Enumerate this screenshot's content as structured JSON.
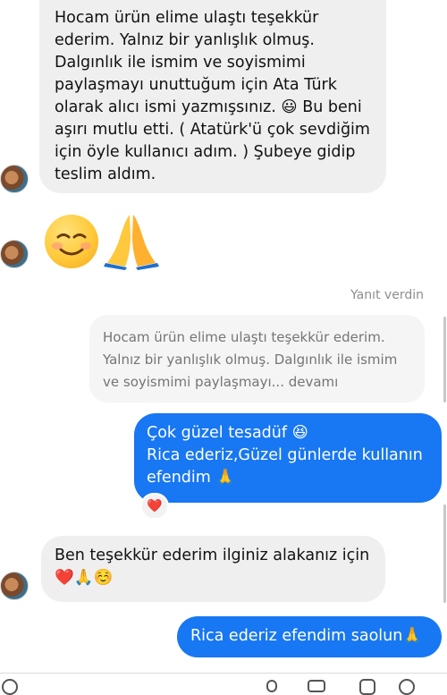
{
  "messages": {
    "m1": "Hocam ürün elime ulaştı teşekkür\nederim. Yalnız bir yanlışlık olmuş.\nDalgınlık ile ismim ve soyismimi\npaylaşmayı unuttuğum için Ata Türk\nolarak alıcı ismi yazmışsınız. 😃 Bu beni\naşırı mutlu etti. ( Atatürk'ü çok sevdiğim\niçin öyle kullanıcı adım. ) Şubeye gidip\nteslim aldım.",
    "m2_emojis": "☺️🙏",
    "reply_label": "Yanıt verdin",
    "quoted": "Hocam ürün elime ulaştı teşekkür ederim.\nYalnız bir yanlışlık olmuş. Dalgınlık ile ismim\nve soyismimi paylaşmayı... devamı",
    "m3": "Çok güzel tesadüf 😆\nRica ederiz,Güzel günlerde kullanın\nefendim 🙏",
    "reaction": "❤️",
    "m4": "Ben teşekkür ederim ilginiz alakanız için\n❤️🙏☺️",
    "m5": "Rica ederiz efendim saolun🙏"
  },
  "colors": {
    "outgoing": "#1877f2",
    "incoming": "#efefef",
    "quoted_text": "#757575"
  },
  "icons": [
    "avatar",
    "heart-reaction-icon",
    "relaxed-face-emoji",
    "folded-hands-emoji"
  ]
}
